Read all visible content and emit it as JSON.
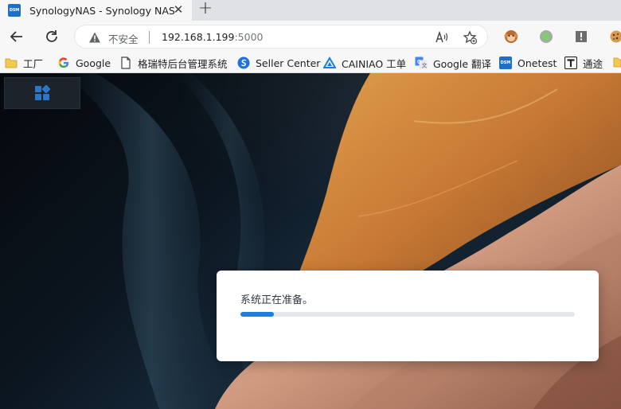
{
  "tab": {
    "favicon_text": "DSM",
    "title": "SynologyNAS - Synology NAS",
    "close_glyph": "✕",
    "new_tab_glyph": "+"
  },
  "address_bar": {
    "security_label": "不安全",
    "url_host": "192.168.1.199",
    "url_port": ":5000"
  },
  "bookmarks": [
    {
      "label": "工厂",
      "icon": "folder-icon"
    },
    {
      "label": "Google",
      "icon": "google-icon"
    },
    {
      "label": "格瑞特后台管理系统",
      "icon": "page-icon"
    },
    {
      "label": "Seller Center",
      "icon": "seller-center-icon"
    },
    {
      "label": "CAINIAO 工单",
      "icon": "cainiao-icon"
    },
    {
      "label": "Google 翻译",
      "icon": "google-translate-icon"
    },
    {
      "label": "Onetest",
      "icon": "dsm-icon"
    },
    {
      "label": "通途",
      "icon": "tongtu-icon"
    }
  ],
  "page": {
    "dialog_message": "系统正在准备。",
    "progress_percent": 10
  },
  "colors": {
    "progress_fill": "#1a7fe0",
    "dsm_brand": "#1d6fc9"
  }
}
